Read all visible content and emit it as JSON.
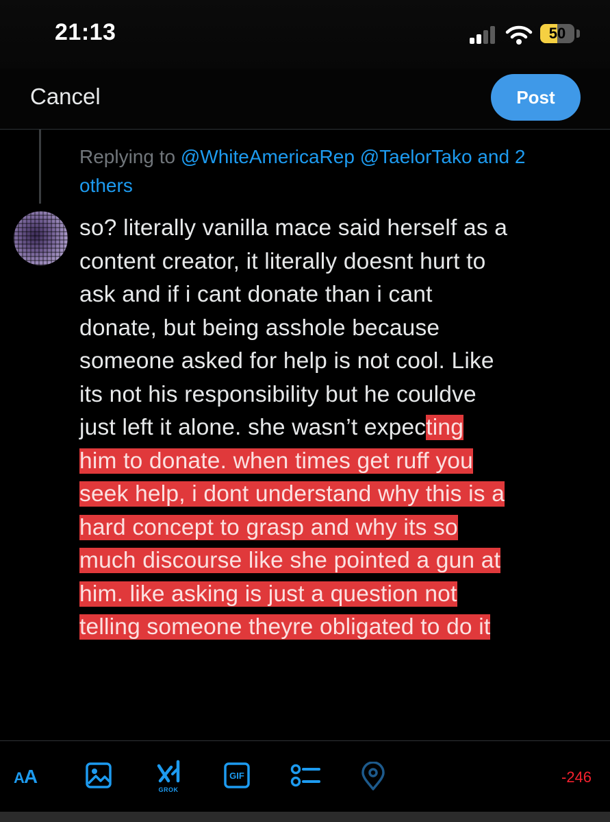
{
  "status_bar": {
    "time": "21:13",
    "battery_percent": "50",
    "battery_level": 0.5,
    "colors": {
      "battery": "#f5d042"
    }
  },
  "header": {
    "cancel_label": "Cancel",
    "post_label": "Post",
    "colors": {
      "post_button": "#3f99e8"
    }
  },
  "reply": {
    "replying_to_label": "Replying to",
    "mentions": [
      "@WhiteAmericaRep",
      "@TaelorTako"
    ],
    "and_label": "and 2",
    "others_label": "others"
  },
  "tweet": {
    "lines": [
      {
        "normal": "so? literally vanilla mace said herself as a",
        "over": ""
      },
      {
        "normal": "content creator, it literally doesnt hurt to",
        "over": ""
      },
      {
        "normal": "ask and if i cant donate than i cant",
        "over": ""
      },
      {
        "normal": "donate, but being asshole because",
        "over": ""
      },
      {
        "normal": "someone asked for help is not cool. Like",
        "over": ""
      },
      {
        "normal": "its not his responsibility but he couldve",
        "over": ""
      },
      {
        "normal": "just left it alone. she wasn’t expec",
        "over": "ting"
      },
      {
        "normal": "",
        "over": "him to donate. when times get ruff you"
      },
      {
        "normal": "",
        "over": "seek help, i dont understand why this is a"
      },
      {
        "normal": "",
        "over": "hard concept to grasp and why its so"
      },
      {
        "normal": "",
        "over": "much discourse like she pointed a gun at"
      },
      {
        "normal": "",
        "over": "him. like asking is just a question not"
      },
      {
        "normal": "",
        "over": "telling someone theyre obligated to do it"
      }
    ],
    "colors": {
      "over_limit_highlight": "#e0393b"
    }
  },
  "toolbar": {
    "text_format_icon": "text-size-icon",
    "image_icon": "image-icon",
    "grok_icon": "grok-icon",
    "grok_label": "GROK",
    "gif_label": "GIF",
    "poll_icon": "poll-list-icon",
    "location_icon": "location-pin-icon",
    "char_count": "-246",
    "colors": {
      "accent": "#1d9bf0",
      "char_count": "#f4212e"
    }
  }
}
